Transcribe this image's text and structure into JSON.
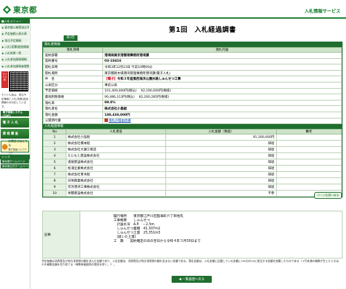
{
  "header": {
    "logo_text": "東京都",
    "service_title": "入札情報サービス"
  },
  "sidebar": {
    "heading": "■入札メニュー",
    "items": [
      "東京都公報等発注予定公表",
      "予定価格公表の表",
      "発注予定情報",
      "入札(見積)経過情報",
      "入札結果一覧",
      "入札参加資格情報",
      "入札参加資格者閲覧"
    ],
    "mobile_badge": "モバイル版",
    "mobile_note": "モバイル版は、発注予定情報と入札(見積)経過情報のみ対応しています。",
    "btn_system": "電子調達システム(TOP)",
    "btn_bid": "電 子 入 札",
    "btn_qualification": "資 格 審 査",
    "inquiry_title": "お問合せはこちら",
    "inquiry_sub": "電子調達ヘルプデスク",
    "links_heading": "リンク",
    "links": [
      "東京都ホームページ",
      "東京都公式ホームページ"
    ]
  },
  "main": {
    "title": "第1回　入札経過調書",
    "tab_round": "第1回",
    "section_info": "落札者情報",
    "col_item": "落札項目",
    "col_content": "落札内容",
    "rows": [
      {
        "k": "契約部署",
        "v": "港湾局東京港管理事務所港湾課"
      },
      {
        "k": "契約番号",
        "v": "03-10416"
      },
      {
        "k": "開札日時",
        "v": "令和3年12月23日 午前10時00分"
      },
      {
        "k": "開札場所",
        "v": "東京都新木場港湾管理事務所港湾課(電子入札)"
      },
      {
        "k": "件　名",
        "v_tag": "【電子】",
        "v": "令和３年度風西海浜公園水路しゅんせつ工事"
      },
      {
        "k": "公表区分",
        "v": "事前公表"
      },
      {
        "k": "予定価格",
        "v": "101,409,000円(税込)　 92,190,000円(税抜)"
      },
      {
        "k": "最低制限価格",
        "v": "90,486,313円(税込)　 82,260,285円(税抜)"
      },
      {
        "k": "落札率",
        "v": "99.0%"
      },
      {
        "k": "落札者名",
        "v": "株式会社小島組"
      },
      {
        "k": "落札金額",
        "v": "100,430,000円"
      },
      {
        "k": "公開添付書",
        "v": "落札の理由他書"
      }
    ],
    "section_bids": "入札経過情報",
    "bid_cols": [
      "No",
      "入札者名",
      "入札金額（税抜）",
      "備考"
    ],
    "bids": [
      {
        "no": "1",
        "name": "株式会社小島組",
        "amt": "91,300,000円",
        "rm": ""
      },
      {
        "no": "2",
        "name": "株式会社橋本組",
        "amt": "辞退",
        "rm": ""
      },
      {
        "no": "3",
        "name": "株式会社大瀬工務店",
        "amt": "辞退",
        "rm": ""
      },
      {
        "no": "4",
        "name": "たにもと建設株式会社",
        "amt": "辞退",
        "rm": ""
      },
      {
        "no": "5",
        "name": "浦屋建設株式会社",
        "amt": "辞退",
        "rm": ""
      },
      {
        "no": "6",
        "name": "松浦企業株式会社",
        "amt": "辞退",
        "rm": ""
      },
      {
        "no": "7",
        "name": "株式会社青木組",
        "amt": "辞退",
        "rm": ""
      },
      {
        "no": "8",
        "name": "日栄興業株式会社",
        "amt": "辞退",
        "rm": ""
      },
      {
        "no": "9",
        "name": "京浜港湾工事株式会社",
        "amt": "辞退",
        "rm": ""
      },
      {
        "no": "10",
        "name": "栄都建設株式会社",
        "amt": "不参",
        "rm": ""
      }
    ],
    "more_button": "ページ先頭へ戻る",
    "notes_label": "記事",
    "notes": [
      "履行場所　　東京都江戸川区臨海町六丁目地先",
      "工事概要　　しゅんせつ",
      "　計画水深　A.P.　－2.5m",
      "　しゅんせつ面積　41,307m2",
      "　しゅんせつ土量　25,351m3",
      "　(抜いた土量)",
      "工　期　　契約確定の日の翌日から令和４年３月30日まで"
    ],
    "footnote": "予定価格は消費税及び地方消費税の額を含んだ金額であり、入札金額は、消費税及び地方消費税の額を含まない金額である。落札金額は、入札金額に記載している金額に100分の10に相当する金額を加算したものである（１円未満の端数が生じたときは、その端数金額を切り捨てる（単数単価契約の場合を除く。））。",
    "back_button": "一覧画面へ戻る"
  }
}
